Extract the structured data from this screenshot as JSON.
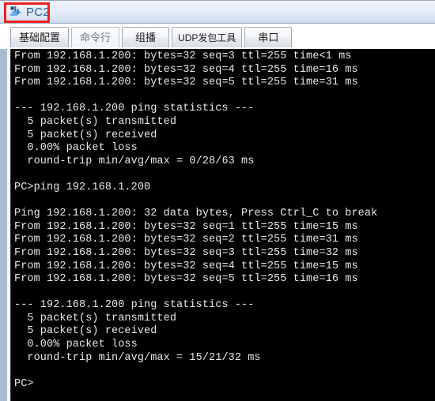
{
  "window": {
    "title": "PC2",
    "icon": "network-device-icon",
    "highlight_color": "#ee2222",
    "title_color": "#2c5f9e"
  },
  "tabs": [
    {
      "id": "basic-config",
      "label": "基础配置",
      "selected": false
    },
    {
      "id": "command-line",
      "label": "命令行",
      "selected": true
    },
    {
      "id": "multicast",
      "label": "组播",
      "selected": false
    },
    {
      "id": "udp-tool",
      "label": "UDP发包工具",
      "selected": false
    },
    {
      "id": "serial-port",
      "label": "串口",
      "selected": false
    }
  ],
  "console": {
    "background": "#000000",
    "foreground": "#e8e8e8",
    "lines": [
      "From 192.168.1.200: bytes=32 seq=3 ttl=255 time<1 ms",
      "From 192.168.1.200: bytes=32 seq=4 ttl=255 time=16 ms",
      "From 192.168.1.200: bytes=32 seq=5 ttl=255 time=31 ms",
      "",
      "--- 192.168.1.200 ping statistics ---",
      "  5 packet(s) transmitted",
      "  5 packet(s) received",
      "  0.00% packet loss",
      "  round-trip min/avg/max = 0/28/63 ms",
      "",
      "PC>ping 192.168.1.200",
      "",
      "Ping 192.168.1.200: 32 data bytes, Press Ctrl_C to break",
      "From 192.168.1.200: bytes=32 seq=1 ttl=255 time=15 ms",
      "From 192.168.1.200: bytes=32 seq=2 ttl=255 time=31 ms",
      "From 192.168.1.200: bytes=32 seq=3 ttl=255 time=32 ms",
      "From 192.168.1.200: bytes=32 seq=4 ttl=255 time=15 ms",
      "From 192.168.1.200: bytes=32 seq=5 ttl=255 time=16 ms",
      "",
      "--- 192.168.1.200 ping statistics ---",
      "  5 packet(s) transmitted",
      "  5 packet(s) received",
      "  0.00% packet loss",
      "  round-trip min/avg/max = 15/21/32 ms",
      "",
      "PC>"
    ]
  }
}
